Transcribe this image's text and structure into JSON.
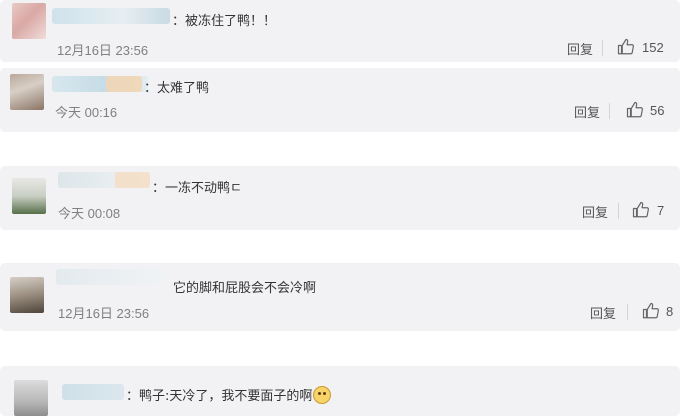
{
  "comments": [
    {
      "text": "：被冻住了鸭！！",
      "time": "12月16日 23:56",
      "reply": "回复",
      "likes": "152"
    },
    {
      "text": "：太难了鸭",
      "time": "今天 00:16",
      "reply": "回复",
      "likes": "56"
    },
    {
      "text": "：一冻不动鸭ㄷ",
      "time": "今天 00:08",
      "reply": "回复",
      "likes": "7"
    },
    {
      "text": "它的脚和屁股会不会冷啊",
      "time": "12月16日 23:56",
      "reply": "回复",
      "likes": "8"
    },
    {
      "text": "：鸭子:天冷了，我不要面子的啊",
      "emoji": "doge-emoji"
    }
  ],
  "icons": {
    "like": "thumbs-up-icon",
    "avatar": "blurred-avatar"
  },
  "colors": {
    "card_bg": "#f2f2f5",
    "time": "#808080",
    "text": "#333333"
  }
}
